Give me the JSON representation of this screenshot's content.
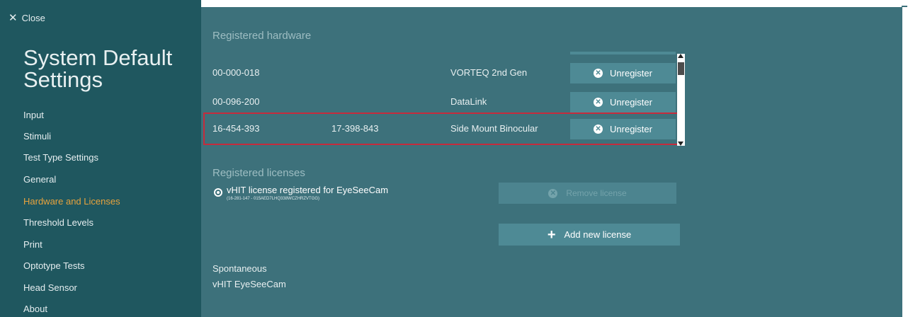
{
  "sidebar": {
    "close_label": "Close",
    "title": "System Default Settings",
    "items": [
      {
        "label": "Input"
      },
      {
        "label": "Stimuli"
      },
      {
        "label": "Test Type Settings"
      },
      {
        "label": "General"
      },
      {
        "label": "Hardware and Licenses",
        "active": true
      },
      {
        "label": "Threshold Levels"
      },
      {
        "label": "Print"
      },
      {
        "label": "Optotype Tests"
      },
      {
        "label": "Head Sensor"
      },
      {
        "label": "About"
      }
    ]
  },
  "hardware": {
    "section_title": "Registered hardware",
    "rows": [
      {
        "serial": "00-000-018",
        "serial2": "",
        "device": "VORTEQ 2nd Gen",
        "button": "Unregister"
      },
      {
        "serial": "00-096-200",
        "serial2": "",
        "device": "DataLink",
        "button": "Unregister"
      },
      {
        "serial": "16-454-393",
        "serial2": "17-398-843",
        "device": "Side Mount Binocular",
        "button": "Unregister"
      }
    ]
  },
  "licenses": {
    "section_title": "Registered licenses",
    "license_name": "vHIT license registered for EyeSeeCam",
    "license_code": "(16-281-147 - 015AED7LHQ338WCZHRZVTGG)",
    "remove_label": "Remove license",
    "add_label": "Add new license"
  },
  "info": {
    "line1": "Spontaneous",
    "line2": "vHIT EyeSeeCam"
  },
  "colors": {
    "sidebar_bg": "#1f575f",
    "main_bg": "#3d717b",
    "button_bg": "#4e8a95",
    "active_nav": "#e8a33d",
    "highlight": "#c62b3c"
  }
}
